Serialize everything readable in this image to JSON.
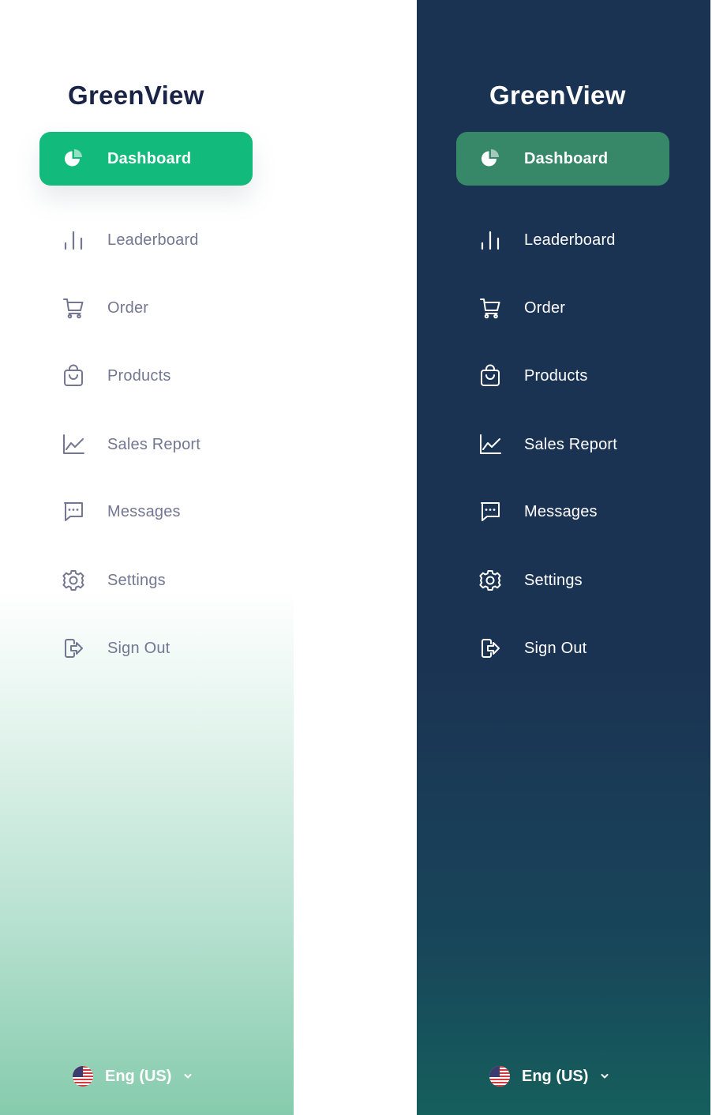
{
  "app": {
    "name": "GreenView"
  },
  "nav": [
    {
      "id": "dashboard",
      "label": "Dashboard",
      "icon": "pie-chart-icon",
      "active": true
    },
    {
      "id": "leaderboard",
      "label": "Leaderboard",
      "icon": "bar-chart-icon"
    },
    {
      "id": "order",
      "label": "Order",
      "icon": "cart-icon"
    },
    {
      "id": "products",
      "label": "Products",
      "icon": "shopping-bag-icon"
    },
    {
      "id": "sales-report",
      "label": "Sales Report",
      "icon": "line-chart-icon"
    },
    {
      "id": "messages",
      "label": "Messages",
      "icon": "message-icon"
    },
    {
      "id": "settings",
      "label": "Settings",
      "icon": "gear-icon"
    },
    {
      "id": "sign-out",
      "label": "Sign Out",
      "icon": "sign-out-icon"
    }
  ],
  "language": {
    "label": "Eng (US)",
    "flag_icon": "us-flag-icon",
    "chevron_icon": "chevron-down-icon"
  },
  "colors": {
    "brand_green": "#12bb7b",
    "dark_active": "#368869",
    "dark_bg": "#1b3353",
    "light_text": "#737791",
    "logo_dark": "#1a2447"
  }
}
